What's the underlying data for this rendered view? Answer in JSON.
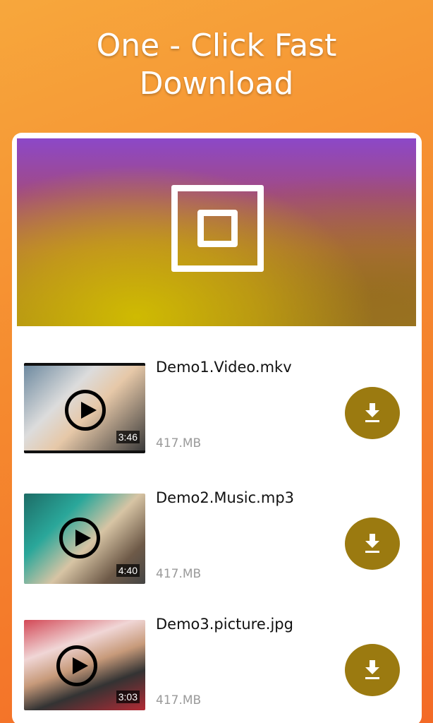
{
  "headline": {
    "line1": "One - Click Fast",
    "line2": "Download"
  },
  "banner": {
    "logo_icon": "square-in-square-logo"
  },
  "items": [
    {
      "name": "Demo1.Video.mkv",
      "size": "417.MB",
      "duration": "3:46"
    },
    {
      "name": "Demo2.Music.mp3",
      "size": "417.MB",
      "duration": "4:40"
    },
    {
      "name": "Demo3.picture.jpg",
      "size": "417.MB",
      "duration": "3:03"
    }
  ],
  "colors": {
    "background_top": "#f7a73c",
    "background_bottom": "#f36a26",
    "download_button": "#9b7a10",
    "card": "#ffffff"
  }
}
